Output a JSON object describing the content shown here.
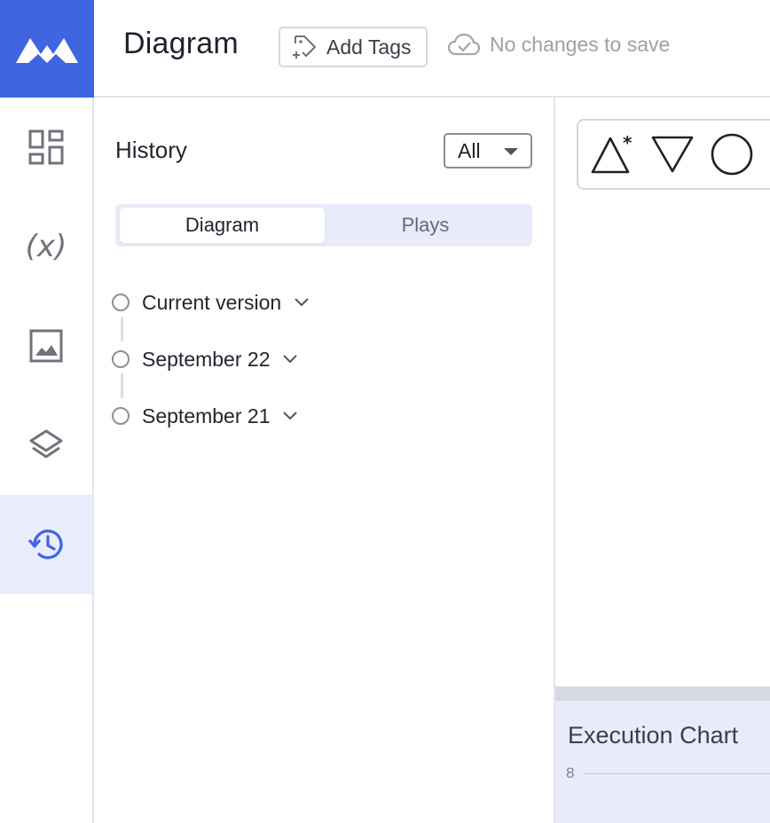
{
  "header": {
    "title": "Diagram",
    "add_tags_label": "Add Tags",
    "save_status": "No changes to save"
  },
  "rail": {
    "items": [
      {
        "icon": "dashboard-icon"
      },
      {
        "icon": "variables-icon",
        "label": "(x)"
      },
      {
        "icon": "image-icon"
      },
      {
        "icon": "layers-icon"
      },
      {
        "icon": "history-icon",
        "active": true
      }
    ]
  },
  "history": {
    "title": "History",
    "filter_value": "All",
    "tabs": [
      {
        "label": "Diagram",
        "active": true
      },
      {
        "label": "Plays",
        "active": false
      }
    ],
    "versions": [
      {
        "label": "Current version"
      },
      {
        "label": "September 22"
      },
      {
        "label": "September 21"
      }
    ]
  },
  "canvas": {
    "shapes": [
      "start-triangle-icon",
      "inverted-triangle-icon",
      "circle-icon"
    ]
  },
  "execution_chart": {
    "title": "Execution Chart",
    "y_tick": "8"
  },
  "colors": {
    "brand": "#3f66e0",
    "active_bg": "#e9ecfa",
    "panel_bg": "#e8ebf9"
  }
}
